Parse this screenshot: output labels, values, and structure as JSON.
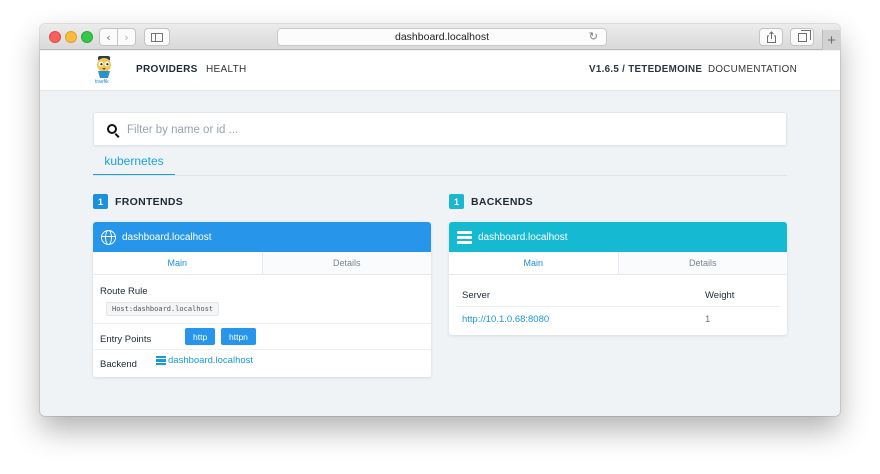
{
  "browser": {
    "url": "dashboard.localhost",
    "back_glyph": "‹",
    "forward_glyph": "›",
    "reload_glyph": "↻",
    "new_tab_glyph": "+"
  },
  "nav": {
    "logo_text": "traefik",
    "providers": "PROVIDERS",
    "health": "HEALTH",
    "version": "V1.6.5 / TETEDEMOINE",
    "documentation": "DOCUMENTATION"
  },
  "search": {
    "placeholder": "Filter by name or id ...",
    "value": ""
  },
  "provider_tab": "kubernetes",
  "frontends": {
    "count": "1",
    "title": "FRONTENDS",
    "card": {
      "name": "dashboard.localhost",
      "tabs": [
        "Main",
        "Details"
      ],
      "route_rule_label": "Route Rule",
      "route_rule_value": "Host:dashboard.localhost",
      "entry_points_label": "Entry Points",
      "entry_points": [
        "http",
        "httpn"
      ],
      "backend_label": "Backend",
      "backend_value": "dashboard.localhost"
    }
  },
  "backends": {
    "count": "1",
    "title": "BACKENDS",
    "card": {
      "name": "dashboard.localhost",
      "tabs": [
        "Main",
        "Details"
      ],
      "columns": [
        "Server",
        "Weight"
      ],
      "rows": [
        {
          "server": "http://10.1.0.68:8080",
          "weight": "1"
        }
      ]
    }
  },
  "colors": {
    "frontend_accent": "#2795e9",
    "backend_accent": "#15b9d2",
    "link": "#1a9ad9"
  }
}
